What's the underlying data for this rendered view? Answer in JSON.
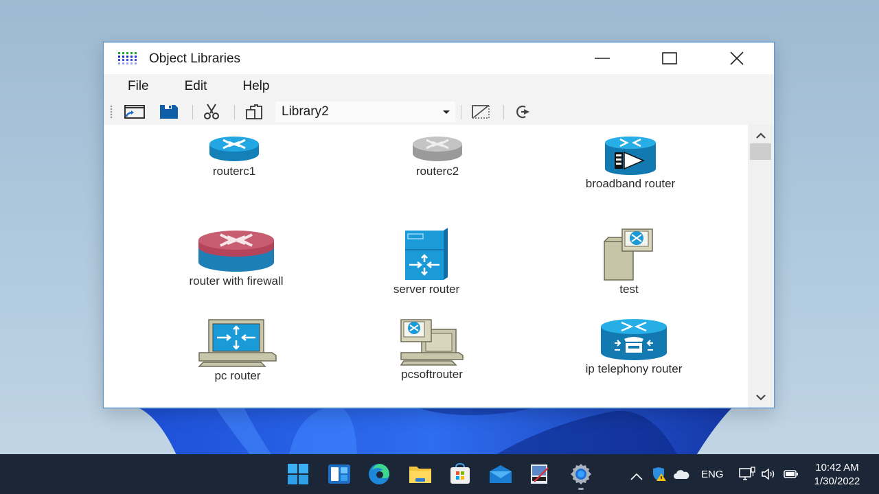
{
  "window": {
    "title": "Object Libraries",
    "app_icon": "grid-app-icon",
    "controls": {
      "minimize": "minimize-icon",
      "maximize": "maximize-icon",
      "close": "close-icon"
    }
  },
  "menu": [
    {
      "label": "File"
    },
    {
      "label": "Edit"
    },
    {
      "label": "Help"
    }
  ],
  "toolbar": {
    "buttons": [
      {
        "name": "open-library",
        "icon": "open-window-icon"
      },
      {
        "name": "save",
        "icon": "save-icon"
      },
      {
        "name": "cut",
        "icon": "scissors-icon"
      },
      {
        "name": "copy",
        "icon": "clipboard-icon"
      },
      {
        "name": "edit-object",
        "icon": "resize-diagonal-icon"
      },
      {
        "name": "refresh",
        "icon": "redo-arrow-icon"
      }
    ],
    "library_select": {
      "value": "Library2"
    }
  },
  "library_items": [
    {
      "label": "routerc1",
      "icon": "router-blue-icon"
    },
    {
      "label": "routerc2",
      "icon": "router-gray-icon"
    },
    {
      "label": "broadband router",
      "icon": "broadband-router-icon"
    },
    {
      "label": "router with firewall",
      "icon": "firewall-router-icon"
    },
    {
      "label": "server router",
      "icon": "server-router-icon"
    },
    {
      "label": "test",
      "icon": "tower-router-icon"
    },
    {
      "label": "pc router",
      "icon": "pc-router-icon"
    },
    {
      "label": "pcsoftrouter",
      "icon": "pc-soft-router-icon"
    },
    {
      "label": "ip telephony router",
      "icon": "ip-telephony-router-icon"
    }
  ],
  "taskbar": {
    "apps": [
      {
        "name": "start",
        "icon": "windows-start-icon"
      },
      {
        "name": "widgets",
        "icon": "widgets-icon"
      },
      {
        "name": "edge",
        "icon": "edge-browser-icon"
      },
      {
        "name": "file-explorer",
        "icon": "folder-icon"
      },
      {
        "name": "store",
        "icon": "store-icon"
      },
      {
        "name": "mail",
        "icon": "mail-icon"
      },
      {
        "name": "paint",
        "icon": "paint-icon"
      },
      {
        "name": "settings",
        "icon": "gear-icon",
        "active": true
      }
    ],
    "tray": {
      "language": "ENG",
      "time": "10:42 AM",
      "date": "1/30/2022"
    }
  }
}
